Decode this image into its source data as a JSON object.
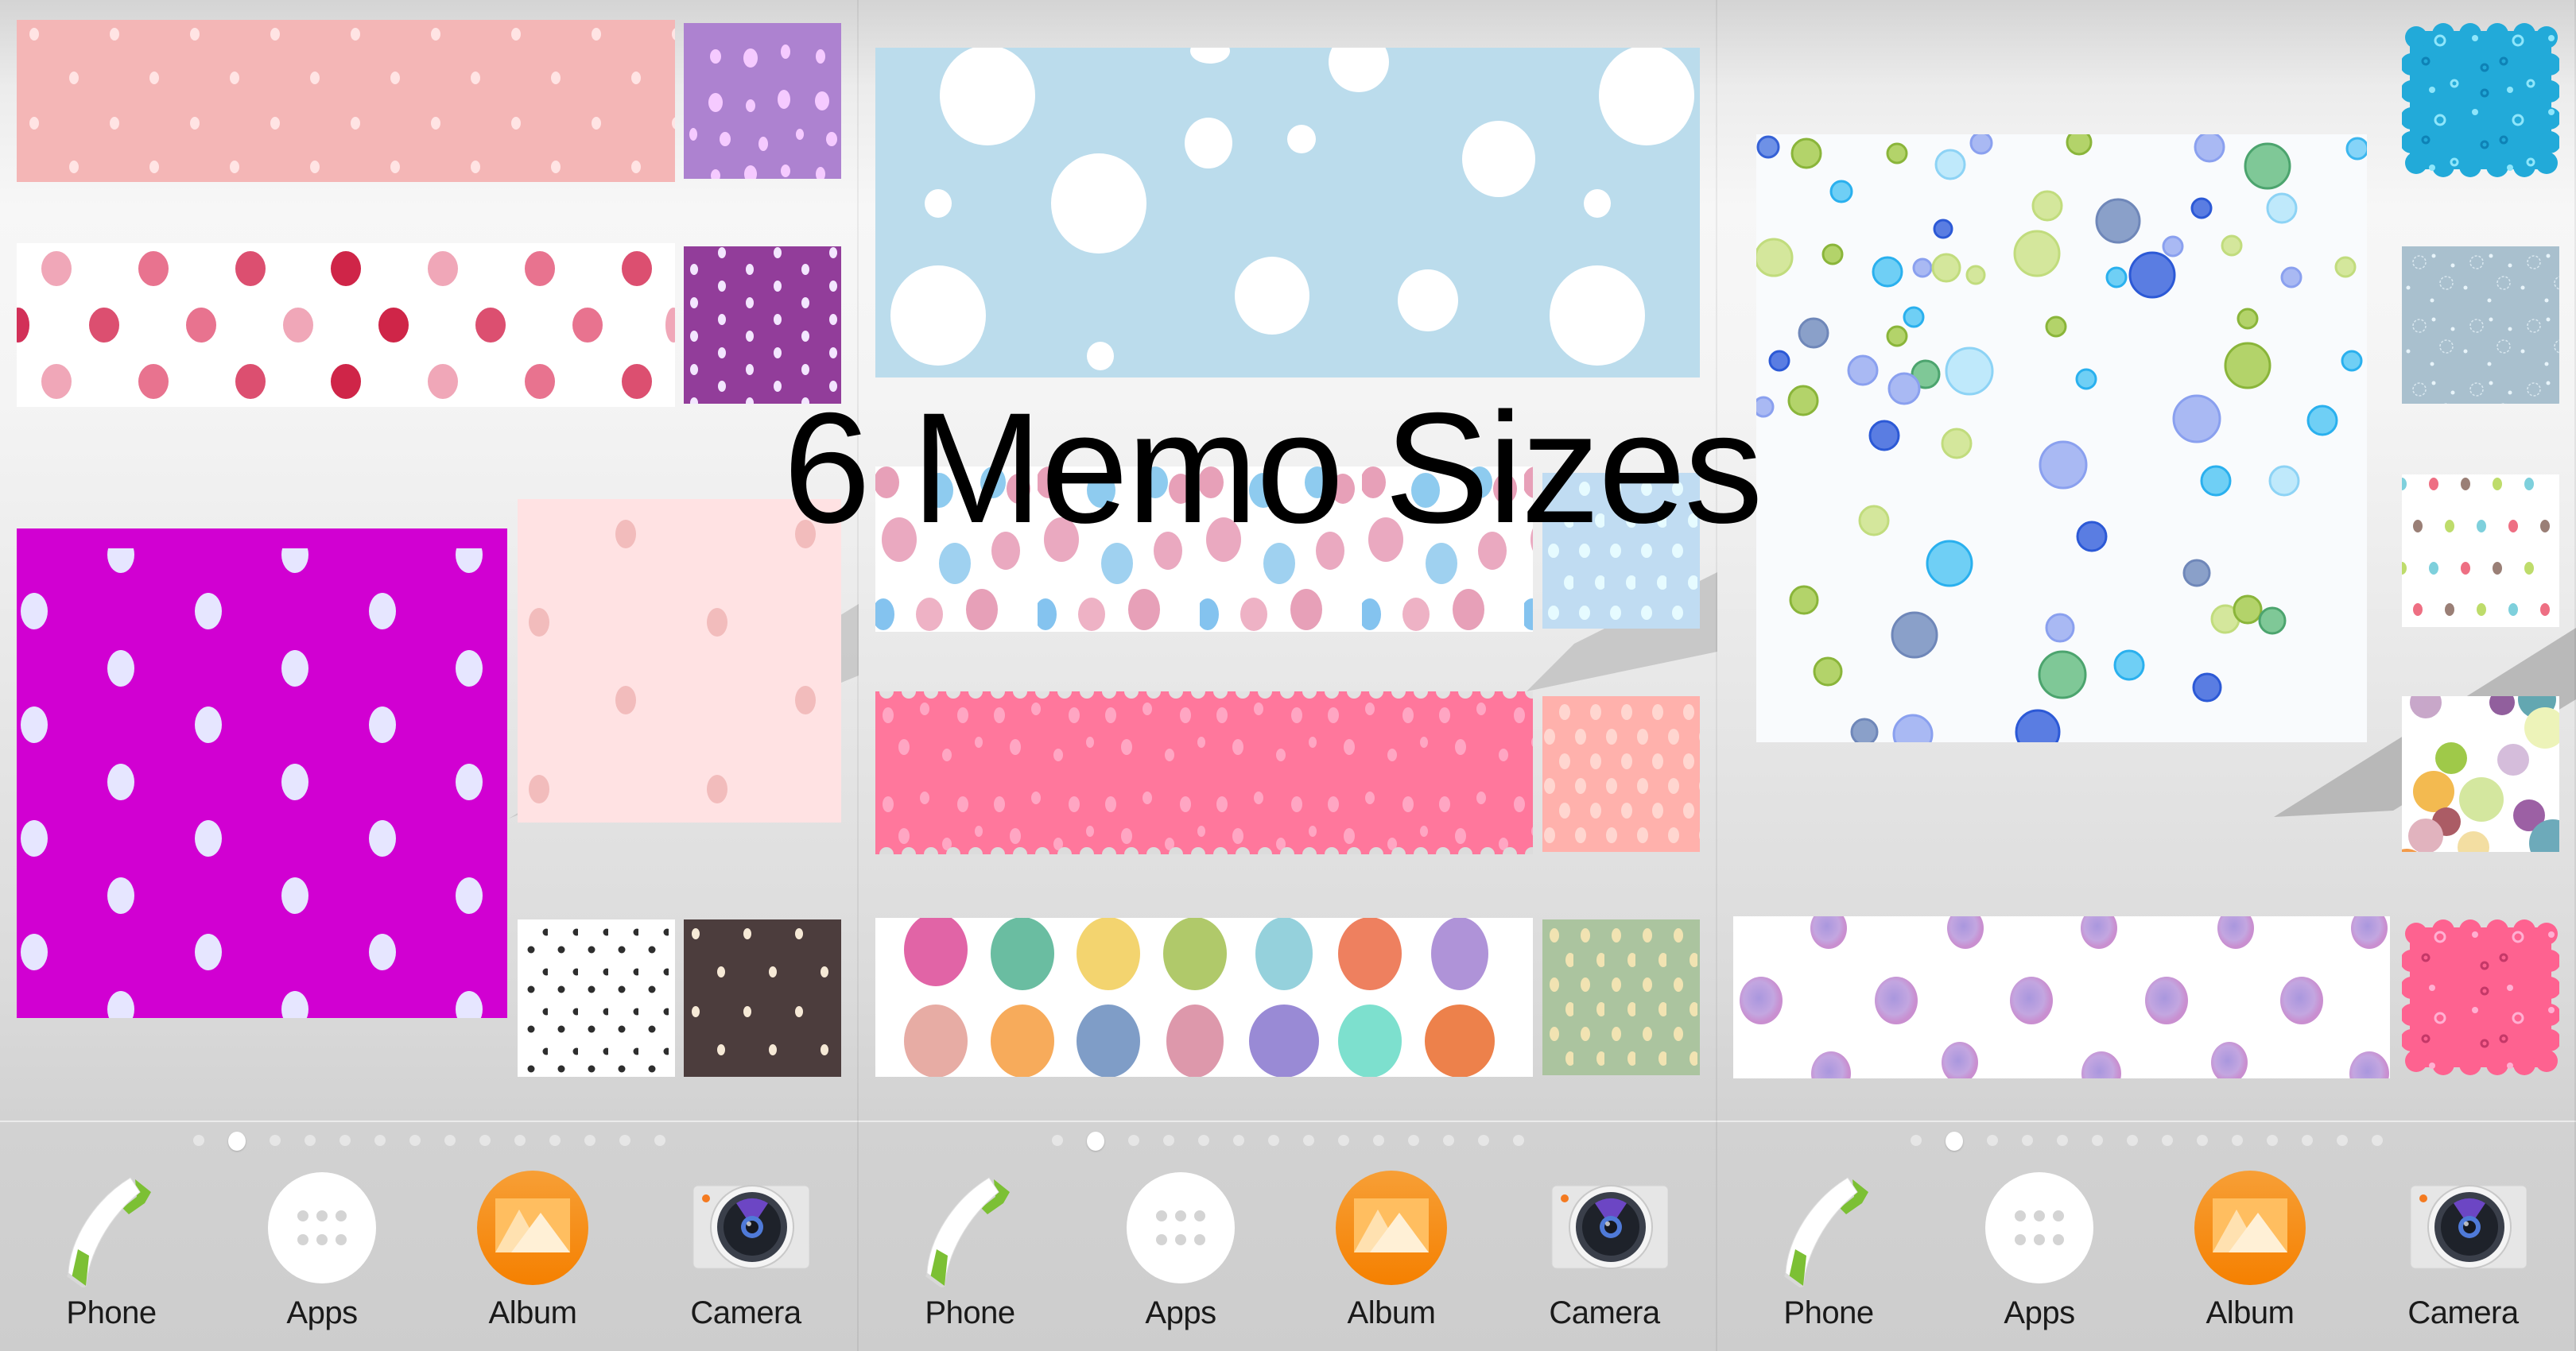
{
  "overlay_title": "6 Memo Sizes",
  "colors": {
    "pink_wide": "#f4b6b6",
    "lavender_small": "#ad82d0",
    "plum_small": "#923d9a",
    "magenta_large": "#d100d2",
    "blush_medium": "#ffe2e3",
    "brown_small": "#4c3d3d",
    "sky_wide": "#bbdcec",
    "light_blue_small": "#c0dcf2",
    "hot_pink_scalloped": "#ff779c",
    "salmon_small": "#ffb1ac",
    "sage_small": "#abc49f",
    "cyan_scalloped": "#22aad9",
    "grey_blue_small": "#a9c0ce",
    "pink_scalloped_small": "#fe6290",
    "album_orange": "#f58a12",
    "phone_green": "#7cc034"
  },
  "screens": [
    {
      "name": "home-screen-1",
      "memos": [
        "pink-polka-wide",
        "lavender-dots-small",
        "red-watercolor-dots-wide",
        "plum-dots-small",
        "magenta-polka-large",
        "blush-dots-medium",
        "black-dots-small",
        "brown-dots-small"
      ]
    },
    {
      "name": "home-screen-2",
      "memos": [
        "sky-bubbles-wide",
        "pink-blue-watercolor-wide",
        "light-blue-dots-small",
        "hot-pink-scalloped-wide",
        "salmon-dots-small",
        "watercolor-blobs-wide",
        "sage-dots-small"
      ]
    },
    {
      "name": "home-screen-3",
      "memos": [
        "glossy-bubbles-large",
        "cyan-scalloped-small",
        "grey-blue-circles-small",
        "multicolor-dots-small",
        "confetti-circles-small",
        "lavender-watercolor-wide",
        "pink-scalloped-small"
      ]
    }
  ],
  "page_indicator": {
    "count": 14,
    "active_index": 1
  },
  "dock": {
    "apps": [
      {
        "label": "Phone",
        "icon": "phone-icon"
      },
      {
        "label": "Apps",
        "icon": "apps-grid-icon"
      },
      {
        "label": "Album",
        "icon": "album-icon"
      },
      {
        "label": "Camera",
        "icon": "camera-icon"
      }
    ]
  }
}
